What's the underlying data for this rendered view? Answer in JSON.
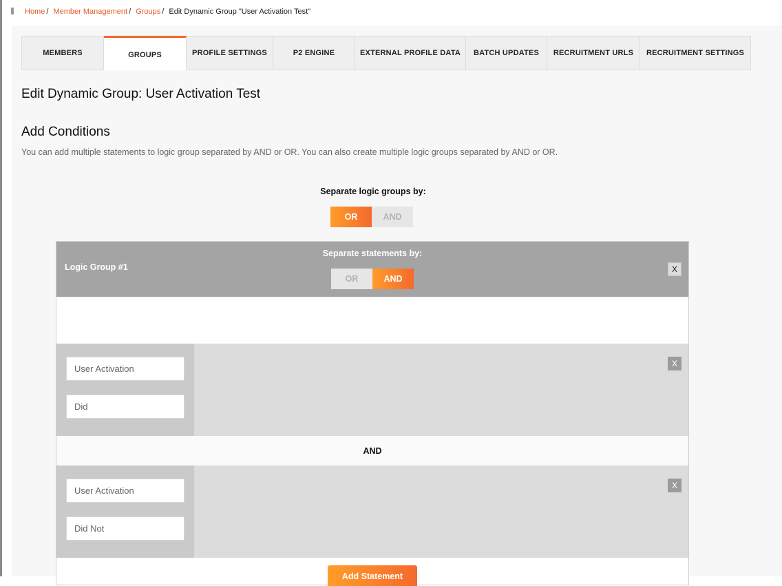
{
  "breadcrumb": {
    "home": "Home",
    "member_management": "Member Management",
    "groups": "Groups",
    "current": "Edit Dynamic Group \"User Activation Test\""
  },
  "tabs": [
    {
      "label": "MEMBERS"
    },
    {
      "label": "GROUPS"
    },
    {
      "label": "PROFILE SETTINGS"
    },
    {
      "label": "P2 ENGINE"
    },
    {
      "label": "EXTERNAL PROFILE DATA"
    },
    {
      "label": "BATCH UPDATES"
    },
    {
      "label": "RECRUITMENT URLS"
    },
    {
      "label": "RECRUITMENT SETTINGS"
    }
  ],
  "active_tab": "GROUPS",
  "page_title": "Edit Dynamic Group: User Activation Test",
  "conditions": {
    "title": "Add Conditions",
    "description": "You can add multiple statements to logic group separated by AND or OR. You can also create multiple logic groups separated by AND or OR.",
    "group_separator_label": "Separate logic groups by:",
    "group_separator": {
      "or": "OR",
      "and": "AND",
      "selected": "OR"
    }
  },
  "logic_group": {
    "title": "Logic Group #1",
    "statement_separator_label": "Separate statements by:",
    "statement_separator": {
      "or": "OR",
      "and": "AND",
      "selected": "AND"
    },
    "close_label": "X",
    "statements": [
      {
        "field": "User Activation",
        "operator": "Did",
        "close_label": "X"
      },
      {
        "field": "User Activation",
        "operator": "Did Not",
        "close_label": "X"
      }
    ],
    "divider": "AND",
    "add_button": "Add Statement"
  },
  "colors": {
    "accent": "#f06a2c",
    "accent_gradient_start": "#ff9c2a",
    "link": "#e25a29",
    "group_header": "#a4a4a4"
  }
}
